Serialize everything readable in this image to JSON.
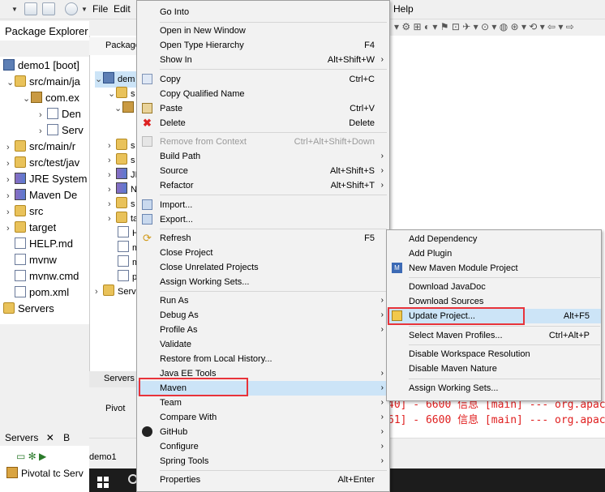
{
  "menubar": {
    "file": "File",
    "edit": "Edit",
    "help": "Help"
  },
  "package_explorer": {
    "title": "Package Explorer",
    "tree": [
      "demo1 [boot]",
      "src/main/ja",
      "com.ex",
      "Den",
      "Serv",
      "src/main/r",
      "src/test/jav",
      "JRE System",
      "Maven De",
      "src",
      "target",
      "HELP.md",
      "mvnw",
      "mvnw.cmd",
      "pom.xml",
      "Servers"
    ]
  },
  "mid_panel": {
    "tab": "Package",
    "root": "dem",
    "rows": [
      "s",
      "s",
      "s",
      "s",
      "JI",
      "N",
      "s",
      "ta",
      "H",
      "m",
      "m",
      "p",
      "Serv"
    ],
    "servers_tab": "Servers",
    "pivotal": "Pivot"
  },
  "bottom": {
    "servers_tab": "Servers",
    "other_tab": "B",
    "pivotal": "Pivotal tc Serv",
    "status": "demo1"
  },
  "console": [
    "40] - 6600 信息 [main] --- org.apac",
    "61] - 6600 信息 [main] --- org.apac"
  ],
  "context_menu": {
    "go_into": "Go Into",
    "open_new_window": "Open in New Window",
    "open_type_hierarchy": "Open Type Hierarchy",
    "open_type_hierarchy_sc": "F4",
    "show_in": "Show In",
    "show_in_sc": "Alt+Shift+W",
    "copy": "Copy",
    "copy_sc": "Ctrl+C",
    "copy_qualified": "Copy Qualified Name",
    "paste": "Paste",
    "paste_sc": "Ctrl+V",
    "delete": "Delete",
    "delete_sc": "Delete",
    "remove_context": "Remove from Context",
    "remove_context_sc": "Ctrl+Alt+Shift+Down",
    "build_path": "Build Path",
    "source": "Source",
    "source_sc": "Alt+Shift+S",
    "refactor": "Refactor",
    "refactor_sc": "Alt+Shift+T",
    "import": "Import...",
    "export": "Export...",
    "refresh": "Refresh",
    "refresh_sc": "F5",
    "close_project": "Close Project",
    "close_unrelated": "Close Unrelated Projects",
    "assign_working_sets": "Assign Working Sets...",
    "run_as": "Run As",
    "debug_as": "Debug As",
    "profile_as": "Profile As",
    "validate": "Validate",
    "restore_history": "Restore from Local History...",
    "java_ee_tools": "Java EE Tools",
    "maven": "Maven",
    "team": "Team",
    "compare_with": "Compare With",
    "github": "GitHub",
    "configure": "Configure",
    "spring_tools": "Spring Tools",
    "properties": "Properties",
    "properties_sc": "Alt+Enter"
  },
  "maven_submenu": {
    "add_dependency": "Add Dependency",
    "add_plugin": "Add Plugin",
    "new_module": "New Maven Module Project",
    "download_javadoc": "Download JavaDoc",
    "download_sources": "Download Sources",
    "update_project": "Update Project...",
    "update_project_sc": "Alt+F5",
    "select_profiles": "Select Maven Profiles...",
    "select_profiles_sc": "Ctrl+Alt+P",
    "disable_workspace": "Disable Workspace Resolution",
    "disable_nature": "Disable Maven Nature",
    "assign_working_sets": "Assign Working Sets..."
  },
  "colors": {
    "highlight": "#cce4f7",
    "annotation_box": "#e8333a",
    "console_text": "#e02020"
  }
}
